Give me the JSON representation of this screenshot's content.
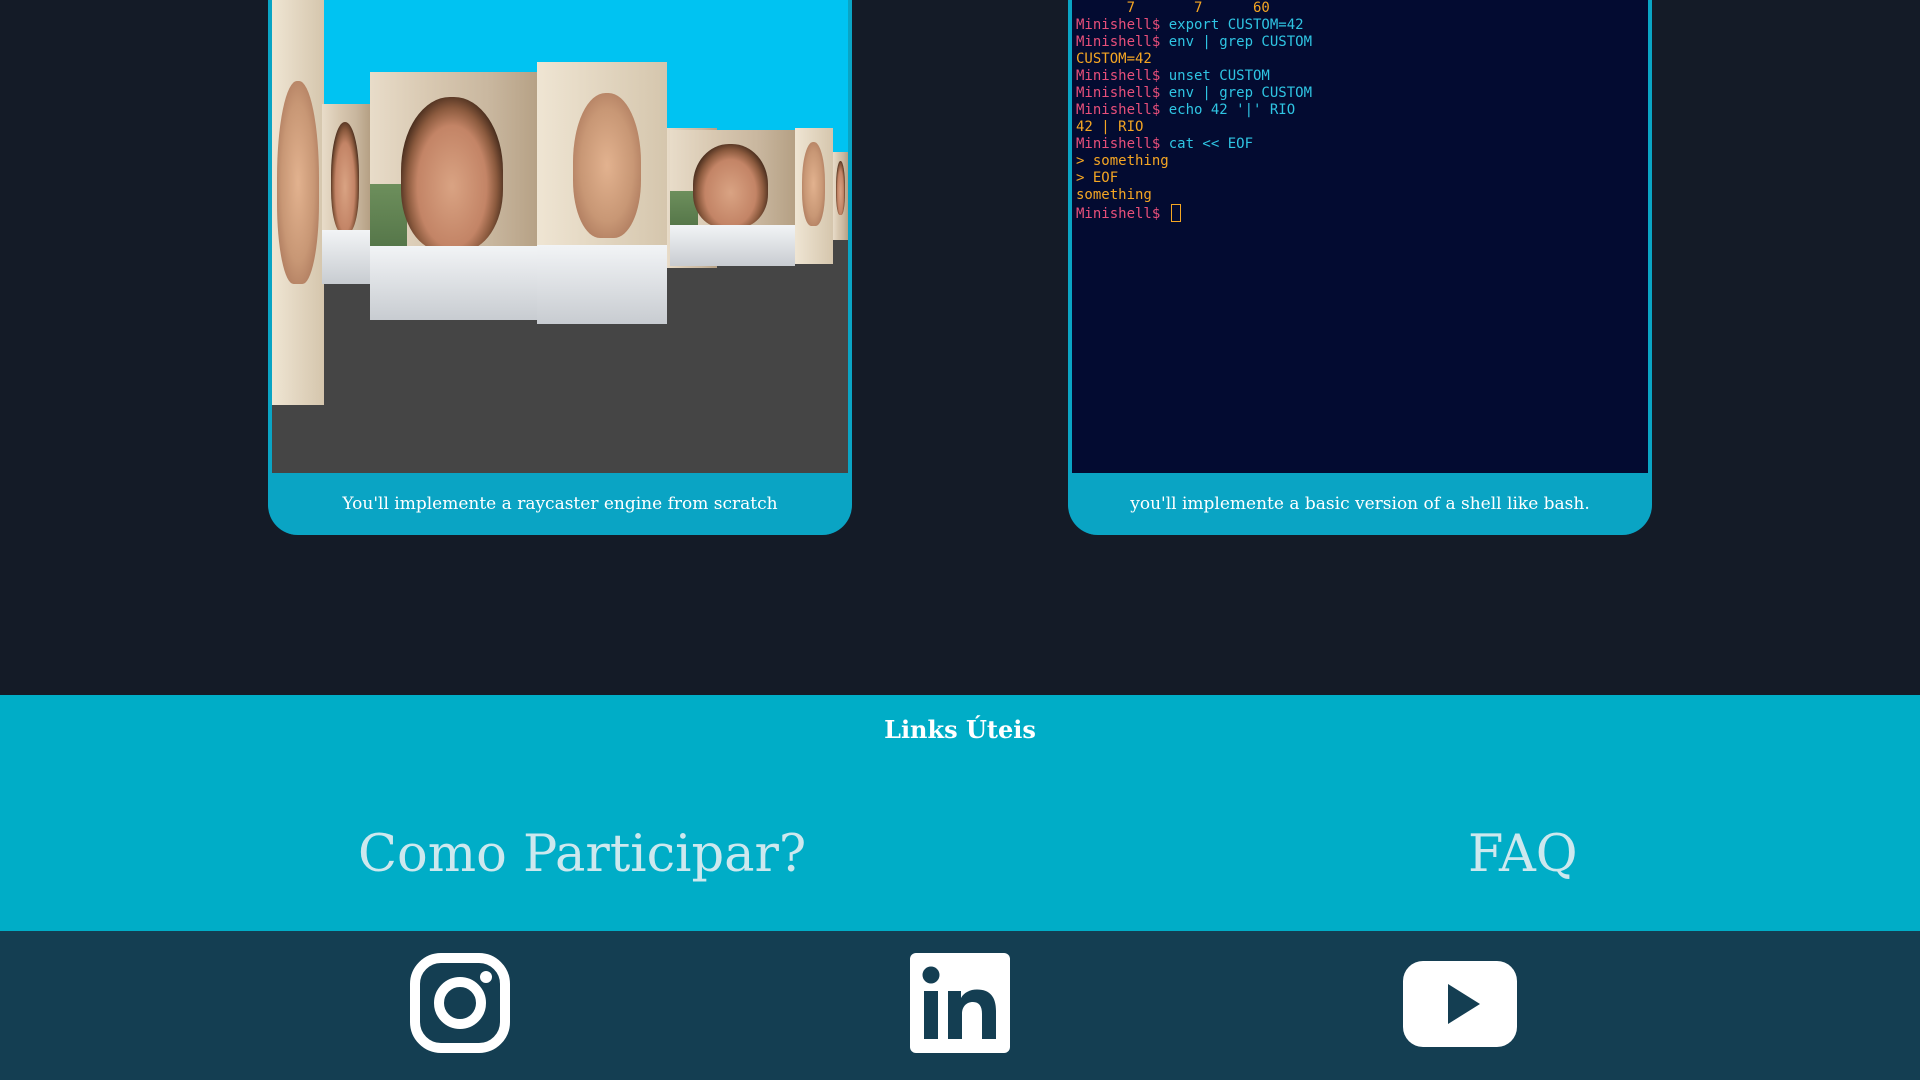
{
  "projects": [
    {
      "id": "cub3d",
      "caption": "You'll implemente a raycaster engine from scratch"
    },
    {
      "id": "minishell",
      "caption": "you'll implemente a basic version of a shell like bash.",
      "terminal": {
        "lines": [
          {
            "prompt": "",
            "cmd": "",
            "out": "      7       7      60"
          },
          {
            "prompt": "Minishell$ ",
            "cmd": "export CUSTOM=42",
            "out": ""
          },
          {
            "prompt": "Minishell$ ",
            "cmd": "env | grep CUSTOM",
            "out": ""
          },
          {
            "prompt": "",
            "cmd": "",
            "out": "CUSTOM=42"
          },
          {
            "prompt": "Minishell$ ",
            "cmd": "unset CUSTOM",
            "out": ""
          },
          {
            "prompt": "Minishell$ ",
            "cmd": "env | grep CUSTOM",
            "out": ""
          },
          {
            "prompt": "Minishell$ ",
            "cmd": "echo 42 '|' RIO",
            "out": ""
          },
          {
            "prompt": "",
            "cmd": "",
            "out": "42 | RIO"
          },
          {
            "prompt": "Minishell$ ",
            "cmd": "cat << EOF",
            "out": ""
          },
          {
            "prompt": "",
            "cmd": "",
            "out": "> something"
          },
          {
            "prompt": "",
            "cmd": "",
            "out": "> EOF"
          },
          {
            "prompt": "",
            "cmd": "",
            "out": "something"
          }
        ],
        "final_prompt": "Minishell$ "
      }
    }
  ],
  "links": {
    "title": "Links Úteis",
    "items": [
      {
        "label": "Como Participar?"
      },
      {
        "label": "FAQ"
      }
    ]
  },
  "social": [
    {
      "name": "instagram-icon"
    },
    {
      "name": "linkedin-icon"
    },
    {
      "name": "youtube-icon"
    }
  ],
  "colors": {
    "background": "#141b27",
    "card": "#0aa4c4",
    "links_band": "#00adc7",
    "footer": "#143e52",
    "terminal_bg": "#030b31",
    "prompt": "#e84f7a",
    "command": "#2fc5e3",
    "output": "#f5a623"
  }
}
